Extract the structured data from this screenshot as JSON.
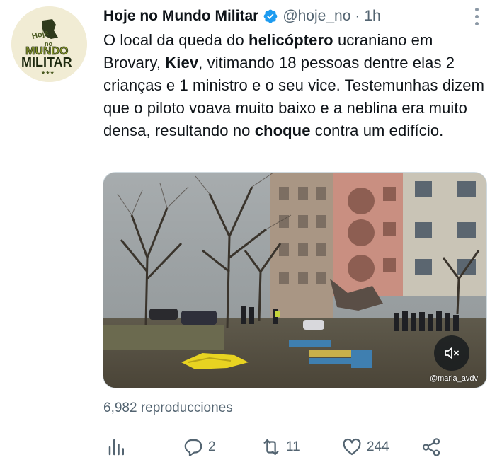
{
  "author": {
    "display_name": "Hoje no Mundo Militar",
    "handle": "@hoje_no",
    "separator": "·",
    "time": "1h",
    "avatar_text": [
      "Hoje",
      "no",
      "MUNDO",
      "MILITAR"
    ]
  },
  "tweet": {
    "segments": [
      {
        "text": "O local da queda do ",
        "bold": false
      },
      {
        "text": "helicóptero",
        "bold": true
      },
      {
        "text": " ucraniano em Brovary, ",
        "bold": false
      },
      {
        "text": "Kiev",
        "bold": true
      },
      {
        "text": ", vitimando 18 pessoas dentre elas 2 crianças e 1 ministro e o seu vice. Testemunhas dizem que o piloto voava muito baixo e a neblina era muito densa, resultando no ",
        "bold": false
      },
      {
        "text": "choque",
        "bold": true
      },
      {
        "text": " contra um edifício.",
        "bold": false
      }
    ]
  },
  "media": {
    "watermark": "@maria_avdv",
    "mute_icon": "speaker-muted-icon"
  },
  "views": "6,982 reproducciones",
  "actions": {
    "analytics_icon": "bar-chart-icon",
    "reply_count": "2",
    "retweet_count": "11",
    "like_count": "244",
    "share_icon": "share-icon"
  },
  "colors": {
    "text": "#0f1419",
    "secondary": "#536471",
    "verified": "#1d9bf0"
  }
}
